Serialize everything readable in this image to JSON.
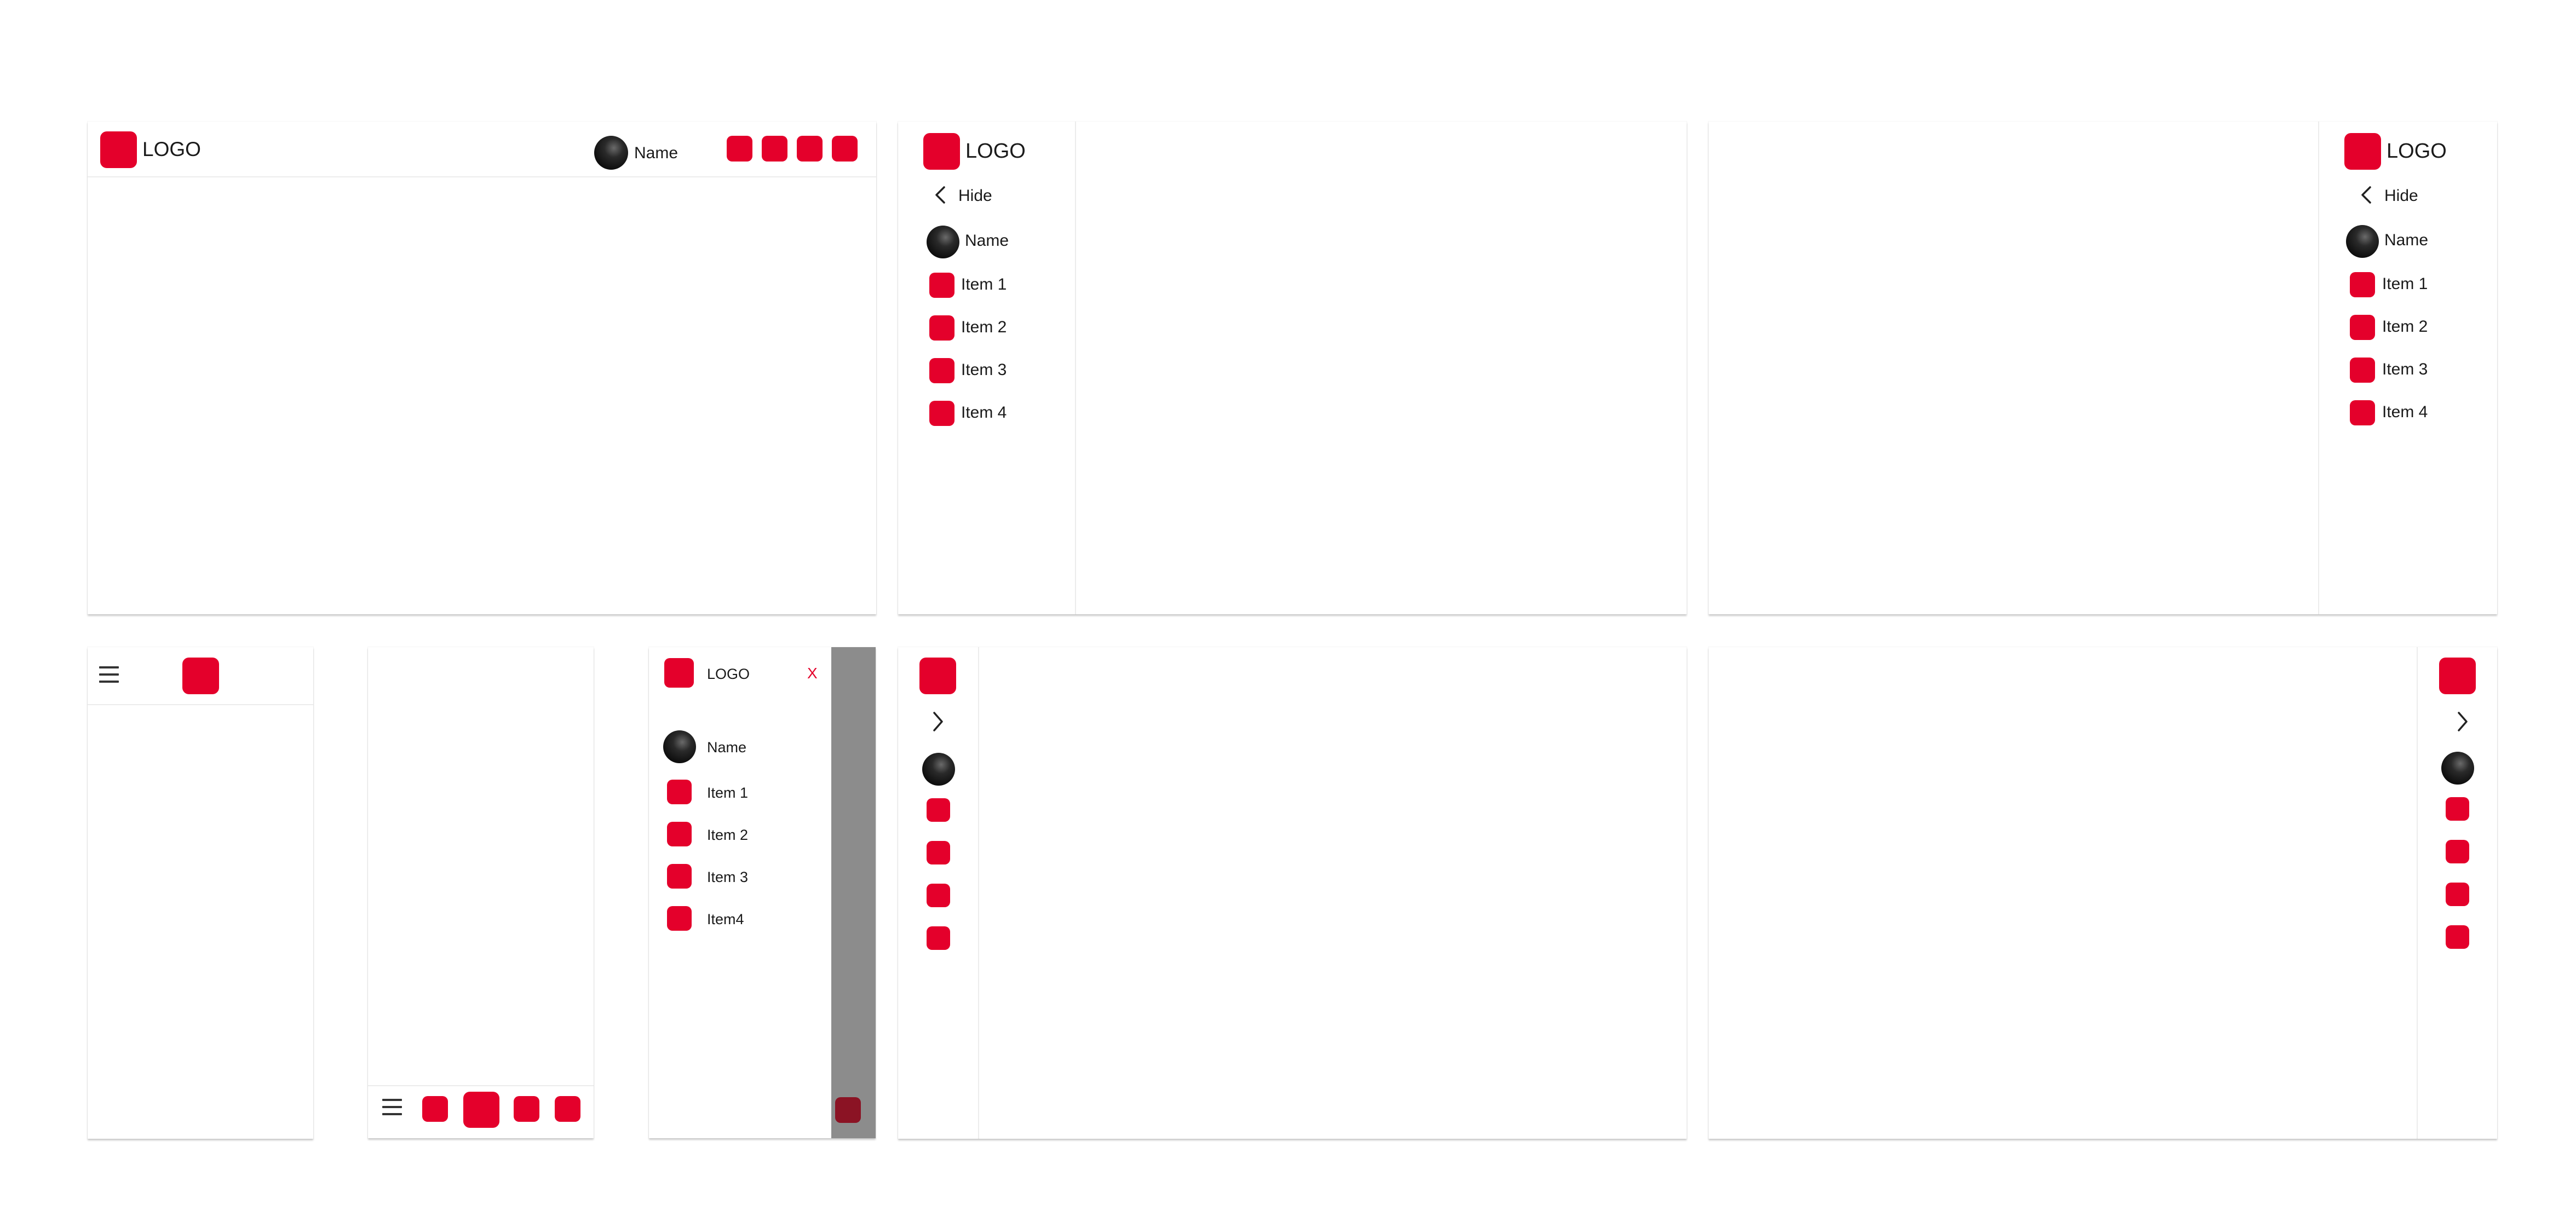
{
  "colors": {
    "accent": "#e4002b",
    "accent_dark": "#8b1324",
    "overlay": "#8c8c8c",
    "text": "#1a1a1a",
    "divider": "#ececec"
  },
  "icons": {
    "logo": "red-square-logo-icon",
    "avatar": "avatar-icon",
    "item": "red-square-icon",
    "hide": "chevron-left-icon",
    "expand": "chevron-right-icon",
    "menu": "hamburger-menu-icon",
    "close": "close-icon"
  },
  "desktop_header": {
    "logo_text": "LOGO",
    "user_name": "Name"
  },
  "sidebar_left": {
    "logo_text": "LOGO",
    "hide_label": "Hide",
    "user_name": "Name",
    "items": [
      "Item 1",
      "Item 2",
      "Item 3",
      "Item 4"
    ]
  },
  "sidebar_right": {
    "logo_text": "LOGO",
    "hide_label": "Hide",
    "user_name": "Name",
    "items": [
      "Item 1",
      "Item 2",
      "Item 3",
      "Item 4"
    ]
  },
  "mobile_drawer": {
    "logo_text": "LOGO",
    "close_label": "X",
    "user_name": "Name",
    "items": [
      "Item 1",
      "Item 2",
      "Item 3",
      "Item4"
    ]
  }
}
